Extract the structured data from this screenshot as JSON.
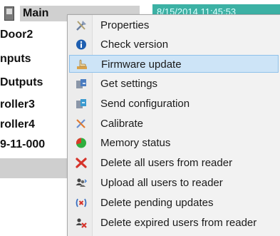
{
  "tree": {
    "root_label": "Main",
    "top_bar_text": "8/15/2014 11:45:53",
    "items": [
      "Door2",
      "nputs",
      "Dutputs",
      "roller3",
      "roller4",
      "9-11-000"
    ]
  },
  "context_menu": {
    "items": [
      {
        "label": "Properties",
        "icon": "tools-icon"
      },
      {
        "label": "Check version",
        "icon": "info-icon"
      },
      {
        "label": "Firmware update",
        "icon": "hand-pointer-icon"
      },
      {
        "label": "Get settings",
        "icon": "get-settings-icon"
      },
      {
        "label": "Send configuration",
        "icon": "send-configuration-icon"
      },
      {
        "label": "Calibrate",
        "icon": "calibrate-icon"
      },
      {
        "label": "Memory status",
        "icon": "pie-chart-icon"
      },
      {
        "label": "Delete all users from reader",
        "icon": "red-x-icon"
      },
      {
        "label": "Upload all users to reader",
        "icon": "users-upload-icon"
      },
      {
        "label": "Delete pending updates",
        "icon": "delete-pending-icon"
      },
      {
        "label": "Delete expired users from reader",
        "icon": "delete-expired-users-icon"
      }
    ],
    "selected_index": 2
  },
  "colors": {
    "selection_fill": "#cde4f7",
    "selection_border": "#8fc1ea",
    "top_bar": "#3cb1a4"
  }
}
